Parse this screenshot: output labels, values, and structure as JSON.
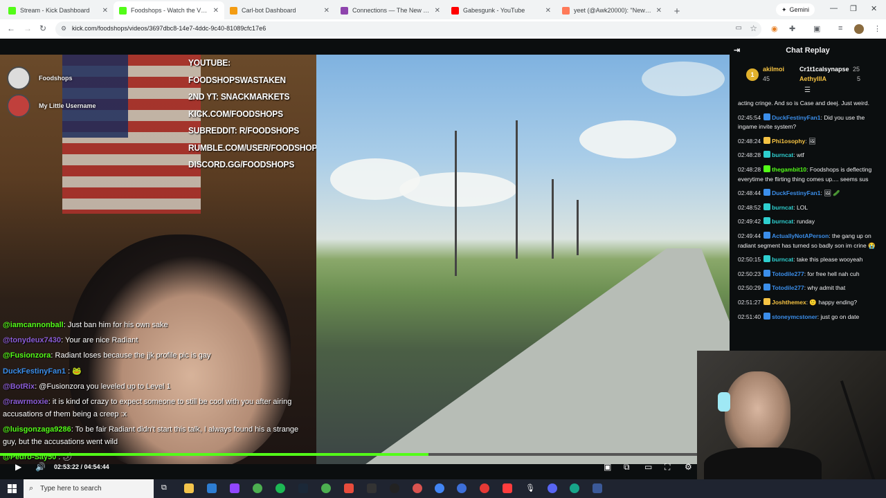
{
  "browser": {
    "tabs": [
      {
        "title": "Stream - Kick Dashboard",
        "color": "#53fc18"
      },
      {
        "title": "Foodshops - Watch the VOD on",
        "color": "#53fc18",
        "active": true
      },
      {
        "title": "Carl-bot Dashboard",
        "color": "#f39c12"
      },
      {
        "title": "Connections — The New York",
        "color": "#8e44ad"
      },
      {
        "title": "Gabesgunk - YouTube",
        "color": "#ff0000"
      },
      {
        "title": "yeet (@Awk20000): \"News 12 o",
        "color": "#ff7a59"
      }
    ],
    "new_tab": "+",
    "gemini_label": "Gemini",
    "url": "kick.com/foodshops/videos/3697dbc8-14e7-4ddc-9c40-81089cfc17e6"
  },
  "video": {
    "streamers": [
      {
        "name": "Foodshops",
        "color": "#dcdcdc"
      },
      {
        "name": "My Little Username",
        "color": "#c0403c"
      }
    ],
    "socials": [
      "YOUTUBE: FOODSHOPSWASTAKEN",
      "2ND YT: SNACKMARKETS",
      "KICK.COM/FOODSHOPS",
      "SUBREDDIT: R/FOODSHOPS",
      "RUMBLE.COM/USER/FOODSHOPS",
      "DISCORD.GG/FOODSHOPS"
    ],
    "overlay_chat": [
      {
        "user": "@iamcannonball",
        "color": "#53fc18",
        "text": ": Just ban him for his own sake"
      },
      {
        "user": "@tonydeux7430",
        "color": "#8a5cd6",
        "text": ": Your are nice Radiant"
      },
      {
        "user": "@Fusionzora",
        "color": "#53fc18",
        "text": ": Radiant loses because the jjk profile pic is gay"
      },
      {
        "user": "DuckFestinyFan1",
        "color": "#3b8eea",
        "text": " : 🐸"
      },
      {
        "user": "@BotRix",
        "color": "#8a5cd6",
        "text": ": @Fusionzora you leveled up to Level 1"
      },
      {
        "user": "@rawrmoxie",
        "color": "#8a5cd6",
        "text": ": it is kind of crazy to expect someone to still be cool with you after airing accusations of them being a creep :x"
      },
      {
        "user": "@luisgonzaga9286",
        "color": "#53fc18",
        "text": ": To be fair Radiant didn't start this talk, I always found his a strange guy, but the accusations went wild"
      },
      {
        "user": "@Pedro-Say50",
        "color": "#53fc18",
        "text": " : 🌶"
      }
    ],
    "progress": 0.587,
    "current_time": "02:53:22",
    "separator": " / ",
    "duration": "04:54:44"
  },
  "chat": {
    "title": "Chat Replay",
    "leaderboard": {
      "rank": "1",
      "first": {
        "name": "akilmoi",
        "count": "45"
      },
      "second": {
        "name": "Cr1t1calsynapse",
        "count": "25"
      },
      "third": {
        "name": "AethyIlIA",
        "count": "5"
      }
    },
    "messages": [
      {
        "time": "",
        "user": "",
        "color": "#53fc18",
        "text": "acting cringe. And so is Case and deej. Just weird."
      },
      {
        "time": "02:45:54",
        "user": "DuckFestinyFan1",
        "color": "#3b8eea",
        "text": ": Did you use the ingame invite system?"
      },
      {
        "time": "02:48:24",
        "user": "Phi1osophy",
        "color": "#f6c343",
        "text": ": 🖼"
      },
      {
        "time": "02:48:28",
        "user": "burncat",
        "color": "#2ecfcf",
        "text": ": wtf"
      },
      {
        "time": "02:48:28",
        "user": "thegambit10",
        "color": "#53fc18",
        "text": ": Foodshops is deflecting everytime the flirting thing comes up.... seems sus"
      },
      {
        "time": "02:48:44",
        "user": "DuckFestinyFan1",
        "color": "#3b8eea",
        "text": ": 🖼 🥒"
      },
      {
        "time": "02:48:52",
        "user": "burncat",
        "color": "#2ecfcf",
        "text": ": LOL"
      },
      {
        "time": "02:49:42",
        "user": "burncat",
        "color": "#2ecfcf",
        "text": ": runday"
      },
      {
        "time": "02:49:44",
        "user": "ActuallyNotAPerson",
        "color": "#3b8eea",
        "text": ": the gang up on radiant segment has turned so badly son im crine 😭"
      },
      {
        "time": "02:50:15",
        "user": "burncat",
        "color": "#2ecfcf",
        "text": ": take this please wooyeah"
      },
      {
        "time": "02:50:23",
        "user": "Totodile277",
        "color": "#3b8eea",
        "text": ": for free hell nah cuh"
      },
      {
        "time": "02:50:29",
        "user": "Totodile277",
        "color": "#3b8eea",
        "text": ": why admit that"
      },
      {
        "time": "02:51:27",
        "user": "Joshthemex",
        "color": "#f6c343",
        "text": ": 🙂 happy ending?"
      },
      {
        "time": "02:51:40",
        "user": "stoneymcstoner",
        "color": "#3b8eea",
        "text": ": just go on date"
      }
    ]
  },
  "taskbar": {
    "search_placeholder": "Type here to search"
  }
}
